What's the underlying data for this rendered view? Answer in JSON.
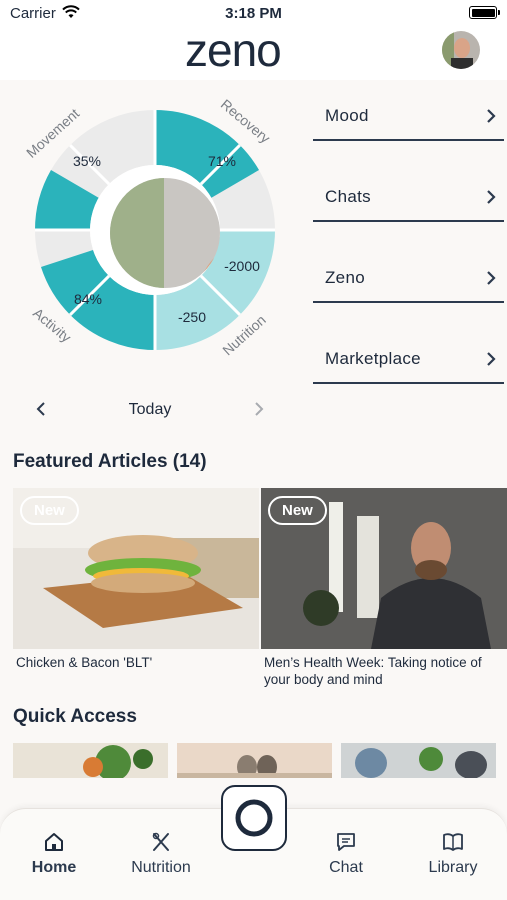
{
  "status_bar": {
    "carrier": "Carrier",
    "time": "3:18 PM"
  },
  "header": {
    "logo_text": "zeno"
  },
  "wheel": {
    "labels": [
      "Movement",
      "Recovery",
      "Activity",
      "Nutrition"
    ],
    "values": {
      "movement": "35%",
      "recovery": "71%",
      "activity": "84%",
      "nutrition_a": "-250",
      "nutrition_b": "-2000"
    },
    "accent": "#2bb3bb",
    "accent_light": "#a8e0e3"
  },
  "menu": [
    {
      "label": "Mood"
    },
    {
      "label": "Chats"
    },
    {
      "label": "Zeno"
    },
    {
      "label": "Marketplace"
    }
  ],
  "day_nav": {
    "label": "Today"
  },
  "featured": {
    "title": "Featured Articles (14)",
    "articles": [
      {
        "badge": "New",
        "title": "Chicken & Bacon 'BLT'"
      },
      {
        "badge": "New",
        "title": "Men’s Health Week: Taking notice of your body and mind"
      }
    ]
  },
  "quick_access": {
    "title": "Quick Access"
  },
  "tabs": [
    {
      "label": "Home",
      "icon": "home-icon"
    },
    {
      "label": "Nutrition",
      "icon": "fork-knife-icon"
    },
    {
      "label": "Chat",
      "icon": "chat-icon"
    },
    {
      "label": "Library",
      "icon": "book-icon"
    }
  ]
}
